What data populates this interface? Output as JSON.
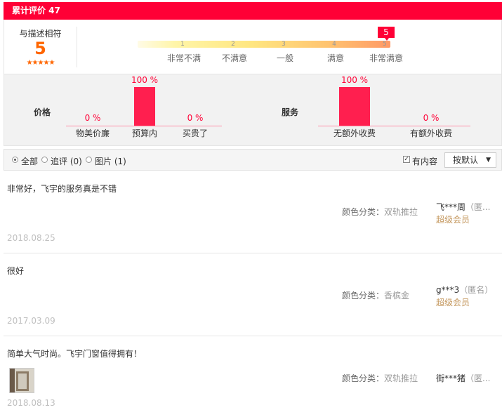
{
  "header": {
    "title": "累计评价 47"
  },
  "score": {
    "title": "与描述相符",
    "value": "5",
    "stars": "★★★★★",
    "current_flag": "5",
    "ticks": [
      "1",
      "2",
      "3",
      "4",
      "5"
    ],
    "tick_labels": [
      "非常不满",
      "不满意",
      "一般",
      "满意",
      "非常满意"
    ]
  },
  "price": {
    "label": "价格",
    "items": [
      {
        "name": "物美价廉",
        "pct": "0 %",
        "value": 0
      },
      {
        "name": "预算内",
        "pct": "100 %",
        "value": 100
      },
      {
        "name": "买贵了",
        "pct": "0 %",
        "value": 0
      }
    ]
  },
  "service": {
    "label": "服务",
    "items": [
      {
        "name": "无额外收费",
        "pct": "100 %",
        "value": 100
      },
      {
        "name": "有额外收费",
        "pct": "0 %",
        "value": 0
      }
    ]
  },
  "filter": {
    "all": "全部",
    "followup": "追评 (0)",
    "pictures": "图片 (1)",
    "has_content": "有内容",
    "sort": "按默认"
  },
  "reviews": [
    {
      "text": "非常好，飞宇的服务真是不错",
      "color_label": "颜色分类：",
      "color_value": "双轨推拉",
      "user": "飞***周",
      "anon": "（匿...",
      "vip": "超级会员",
      "date": "2018.08.25",
      "has_image": false
    },
    {
      "text": "很好",
      "color_label": "颜色分类：",
      "color_value": "香槟金",
      "user": "g***3",
      "anon": "（匿名）",
      "vip": "超级会员",
      "date": "2017.03.09",
      "has_image": false
    },
    {
      "text": "简单大气时尚。飞宇门窗值得拥有！",
      "color_label": "颜色分类：",
      "color_value": "双轨推拉",
      "user": "街***猪",
      "anon": "（匿...",
      "vip": "",
      "date": "2018.08.13",
      "has_image": true
    }
  ],
  "colors": {
    "accent": "#ff0036",
    "score": "#ff6600",
    "vip": "#c4975d"
  }
}
